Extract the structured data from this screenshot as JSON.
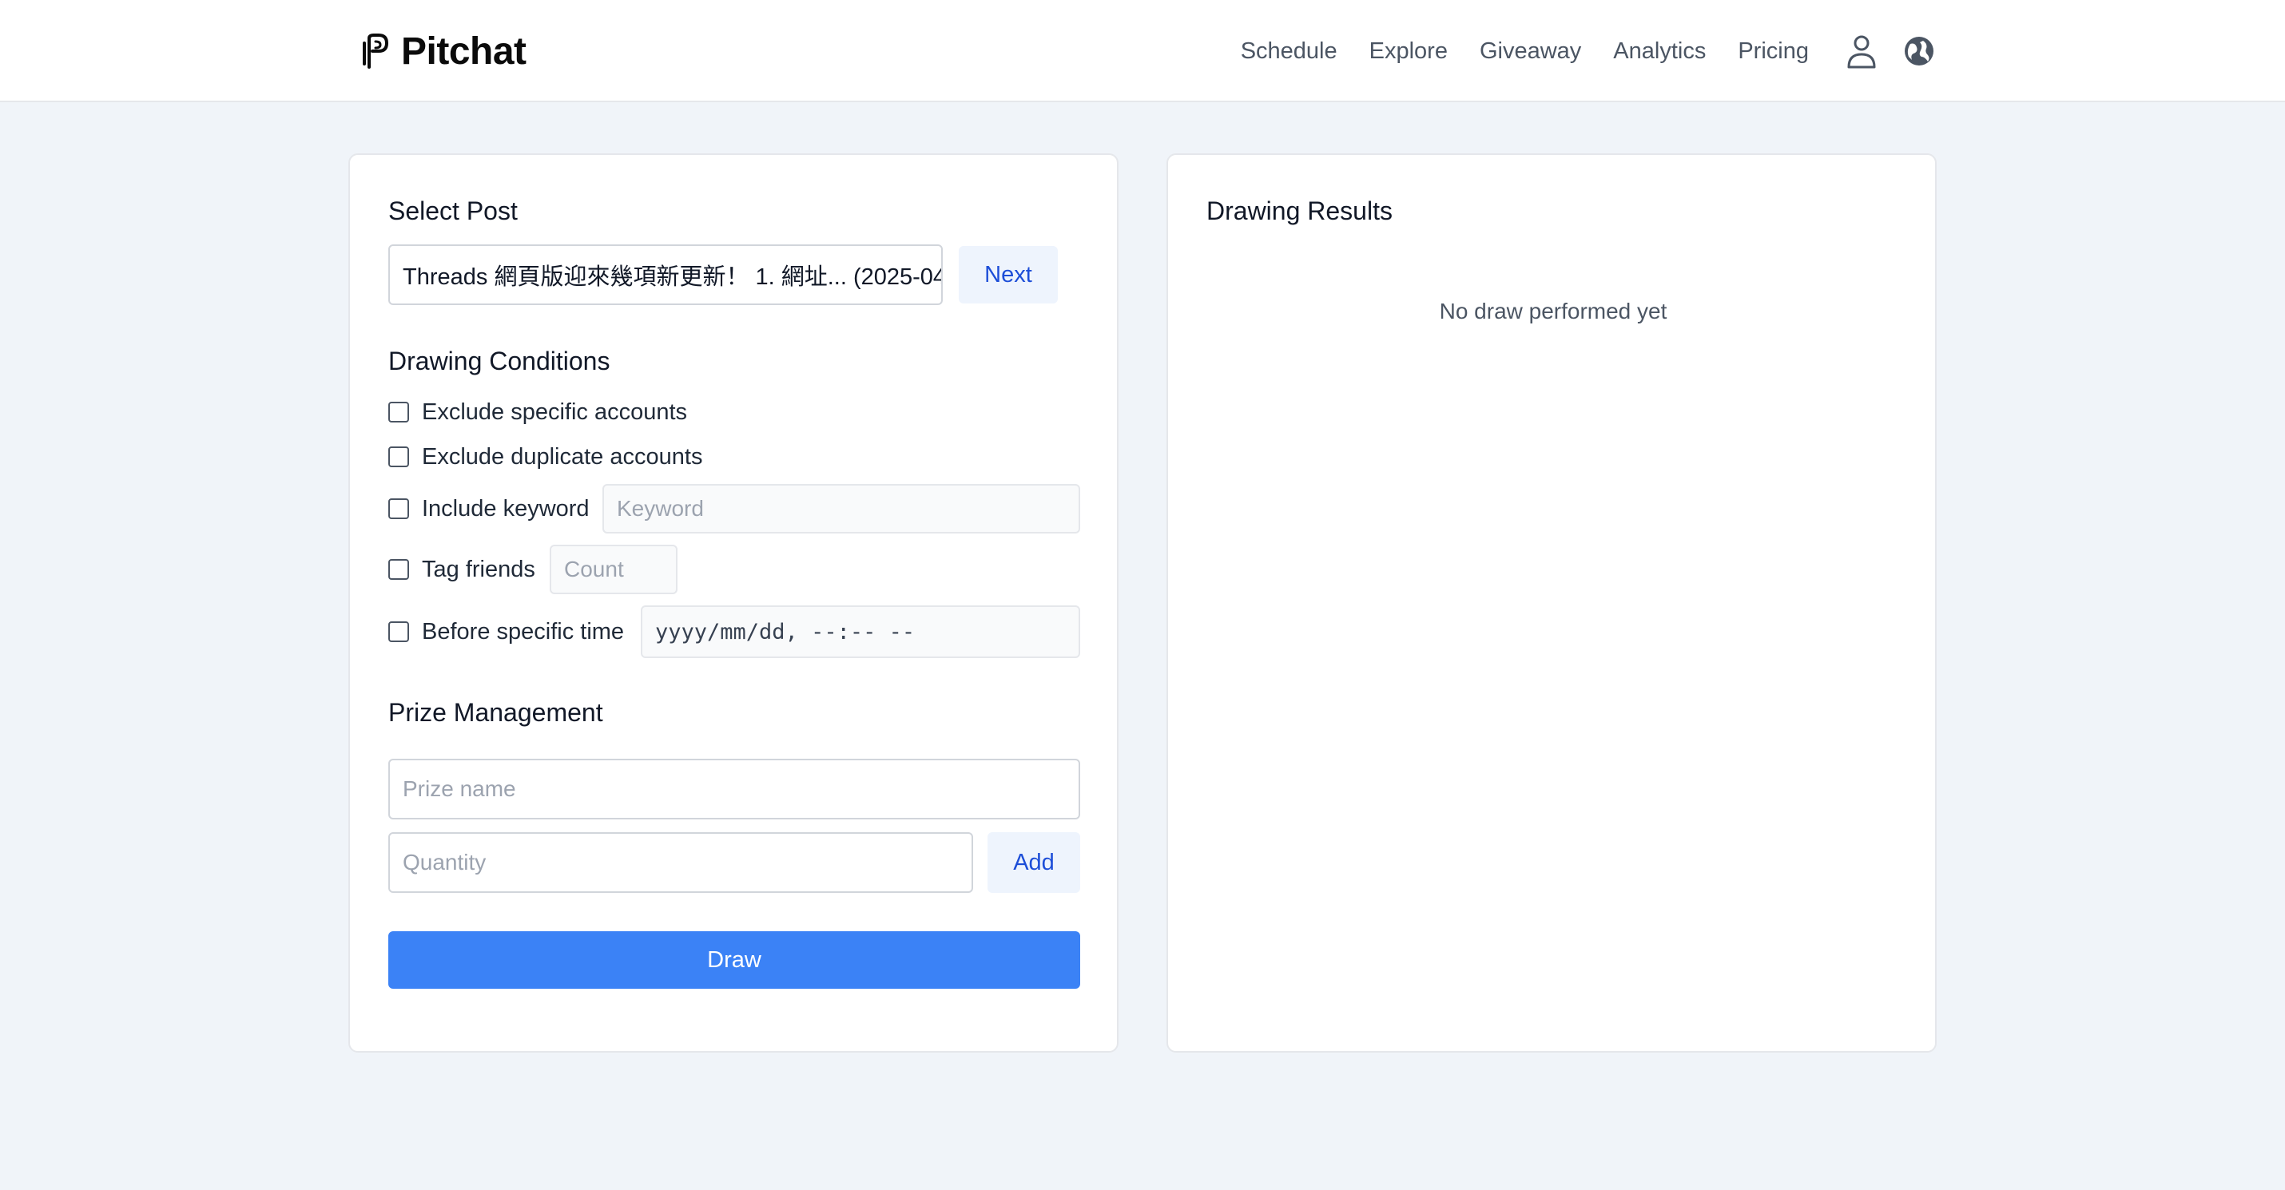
{
  "header": {
    "brand": "Pitchat",
    "nav": [
      "Schedule",
      "Explore",
      "Giveaway",
      "Analytics",
      "Pricing"
    ],
    "icons": [
      "user-icon",
      "globe-icon"
    ]
  },
  "left": {
    "select_post_title": "Select Post",
    "selected_post": "Threads 網頁版迎來幾項新更新！ 1. 網址... (2025-04",
    "next_label": "Next",
    "conditions_title": "Drawing Conditions",
    "conditions": {
      "exclude_specific": "Exclude specific accounts",
      "exclude_duplicate": "Exclude duplicate accounts",
      "include_keyword": "Include keyword",
      "keyword_placeholder": "Keyword",
      "tag_friends": "Tag friends",
      "count_placeholder": "Count",
      "before_time": "Before specific time",
      "datetime_value": "yyyy/mm/dd, --:-- --"
    },
    "prize_title": "Prize Management",
    "prize_name_placeholder": "Prize name",
    "quantity_placeholder": "Quantity",
    "add_label": "Add",
    "draw_label": "Draw"
  },
  "right": {
    "title": "Drawing Results",
    "empty": "No draw performed yet"
  },
  "colors": {
    "primary": "#3b82f6",
    "light_button_bg": "#eef4fd",
    "light_button_text": "#1d4ed8",
    "page_bg": "#f0f4f9"
  }
}
